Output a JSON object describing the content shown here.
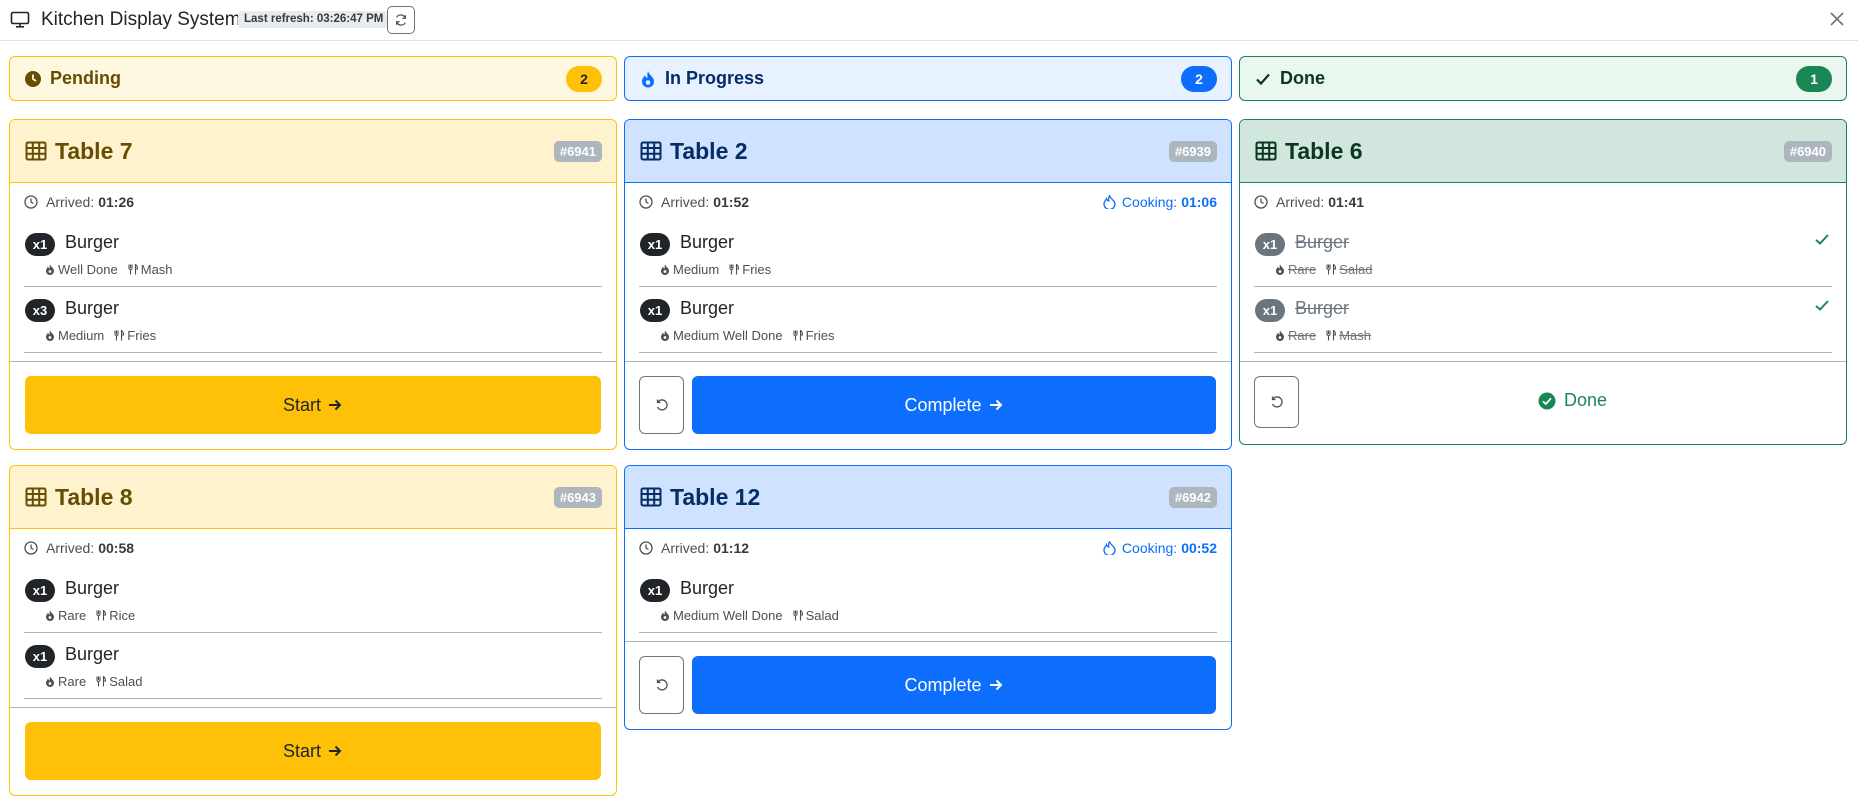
{
  "app": {
    "title": "Kitchen Display System",
    "last_refresh": "Last refresh: 03:26:47 PM",
    "icons": {
      "app": "monitor-icon",
      "refresh": "refresh-icon",
      "close": "close-icon"
    }
  },
  "columns": [
    {
      "key": "pending",
      "label": "Pending",
      "count": "2",
      "icon": "clock-icon",
      "color": "#ffc107"
    },
    {
      "key": "progress",
      "label": "In Progress",
      "count": "2",
      "icon": "flame-icon",
      "color": "#0d6efd"
    },
    {
      "key": "done",
      "label": "Done",
      "count": "1",
      "icon": "check-icon",
      "color": "#198754"
    }
  ],
  "labels": {
    "arrived": "Arrived:",
    "cooking": "Cooking:",
    "start": "Start",
    "complete": "Complete",
    "done": "Done"
  },
  "orders": {
    "t7": {
      "table": "Table 7",
      "id": "#6941",
      "arrived": "01:26",
      "items": [
        {
          "qty": "x1",
          "name": "Burger",
          "doneness": "Well Done",
          "side": "Mash"
        },
        {
          "qty": "x3",
          "name": "Burger",
          "doneness": "Medium",
          "side": "Fries"
        }
      ]
    },
    "t8": {
      "table": "Table 8",
      "id": "#6943",
      "arrived": "00:58",
      "items": [
        {
          "qty": "x1",
          "name": "Burger",
          "doneness": "Rare",
          "side": "Rice"
        },
        {
          "qty": "x1",
          "name": "Burger",
          "doneness": "Rare",
          "side": "Salad"
        }
      ]
    },
    "t2": {
      "table": "Table 2",
      "id": "#6939",
      "arrived": "01:52",
      "cooking": "01:06",
      "items": [
        {
          "qty": "x1",
          "name": "Burger",
          "doneness": "Medium",
          "side": "Fries"
        },
        {
          "qty": "x1",
          "name": "Burger",
          "doneness": "Medium Well Done",
          "side": "Fries"
        }
      ]
    },
    "t12": {
      "table": "Table 12",
      "id": "#6942",
      "arrived": "01:12",
      "cooking": "00:52",
      "items": [
        {
          "qty": "x1",
          "name": "Burger",
          "doneness": "Medium Well Done",
          "side": "Salad"
        }
      ]
    },
    "t6": {
      "table": "Table 6",
      "id": "#6940",
      "arrived": "01:41",
      "items": [
        {
          "qty": "x1",
          "name": "Burger",
          "doneness": "Rare",
          "side": "Salad"
        },
        {
          "qty": "x1",
          "name": "Burger",
          "doneness": "Rare",
          "side": "Mash"
        }
      ]
    }
  }
}
